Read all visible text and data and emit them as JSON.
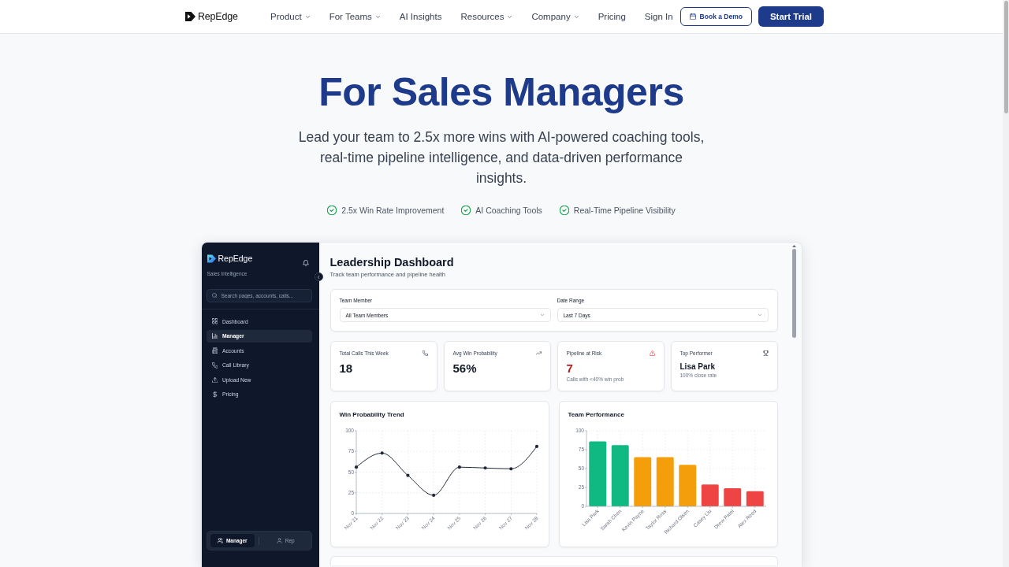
{
  "nav": {
    "logo": "RepEdge",
    "links": [
      {
        "label": "Product",
        "dropdown": true
      },
      {
        "label": "For Teams",
        "dropdown": true
      },
      {
        "label": "AI Insights",
        "dropdown": false
      },
      {
        "label": "Resources",
        "dropdown": true
      },
      {
        "label": "Company",
        "dropdown": true
      },
      {
        "label": "Pricing",
        "dropdown": false
      }
    ],
    "sign_in": "Sign In",
    "demo_button": "Book a Demo",
    "trial_button": "Start Trial"
  },
  "hero": {
    "title": "For Sales Managers",
    "subtitle": "Lead your team to 2.5x more wins with AI-powered coaching tools, real-time pipeline intelligence, and data-driven performance insights.",
    "highlights": [
      "2.5x Win Rate Improvement",
      "AI Coaching Tools",
      "Real-Time Pipeline Visibility"
    ]
  },
  "dashboard": {
    "sidebar": {
      "logo": "RepEdge",
      "tagline": "Sales Intelligence",
      "search": {
        "placeholder": "Search pages, accounts, calls..."
      },
      "items": [
        {
          "label": "Dashboard",
          "selected": false
        },
        {
          "label": "Manager",
          "selected": true
        },
        {
          "label": "Accounts",
          "selected": false
        },
        {
          "label": "Call Library",
          "selected": false
        },
        {
          "label": "Upload New",
          "selected": false
        },
        {
          "label": "Pricing",
          "selected": false
        }
      ],
      "roles": [
        {
          "label": "Manager",
          "selected": true
        },
        {
          "label": "Rep",
          "selected": false
        }
      ]
    },
    "header": {
      "title": "Leadership Dashboard",
      "subtitle": "Track team performance and pipeline health"
    },
    "filters": [
      {
        "label": "Team Member",
        "value": "All Team Members"
      },
      {
        "label": "Date Range",
        "value": "Last 7 Days"
      }
    ],
    "stats": [
      {
        "kind": "metric",
        "label": "Total Calls This Week",
        "value": "18"
      },
      {
        "kind": "metric",
        "label": "Avg Win Probability",
        "value": "56%"
      },
      {
        "kind": "alert",
        "label": "Pipeline at Risk",
        "value": "7",
        "note": "Calls with <40% win prob"
      },
      {
        "kind": "person",
        "label": "Top Performer",
        "value": "Lisa Park",
        "note": "100% close rate"
      }
    ],
    "charts": [
      {
        "chart_data": {
          "type": "line",
          "title": "Win Probability Trend",
          "categories": [
            "Nov 21",
            "Nov 22",
            "Nov 23",
            "Nov 24",
            "Nov 25",
            "Nov 26",
            "Nov 27",
            "Nov 28"
          ],
          "series": [
            {
              "color": "#1f2937",
              "values": [
                56,
                73,
                46,
                22,
                56,
                55,
                54,
                81
              ]
            }
          ],
          "ylim": [
            0,
            100
          ],
          "yticks": [
            0,
            25,
            50,
            75,
            100
          ],
          "grid": true
        }
      },
      {
        "chart_data": {
          "type": "bar",
          "title": "Team Performance",
          "categories": [
            "Lisa Park",
            "Sarah Chen",
            "Kevin Payne",
            "Taylor Ross",
            "Richard Olsen",
            "Casey Liu",
            "Drew Patel",
            "Alex Reed"
          ],
          "series": [
            {
              "color": "#10b981",
              "values": [
                86,
                81,
                null,
                null,
                null,
                null,
                null,
                null
              ]
            },
            {
              "color": "#f59e0b",
              "values": [
                null,
                null,
                65,
                65,
                55,
                null,
                null,
                null
              ]
            },
            {
              "color": "#ef4444",
              "values": [
                null,
                null,
                null,
                null,
                null,
                29,
                24,
                20
              ]
            }
          ],
          "stacked": true,
          "ylim": [
            0,
            100
          ],
          "yticks": [
            0,
            25,
            50,
            75,
            100
          ],
          "grid": true
        }
      }
    ]
  }
}
